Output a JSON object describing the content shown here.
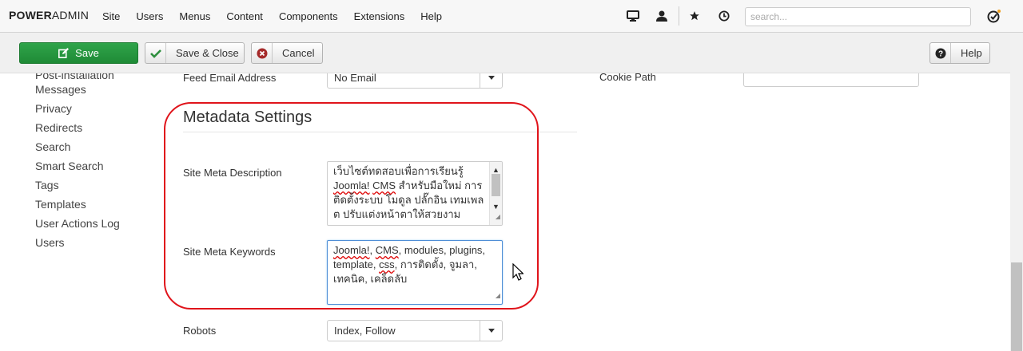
{
  "navbar": {
    "brand_bold": "POWER",
    "brand_rest": "ADMIN",
    "menu": [
      "Site",
      "Users",
      "Menus",
      "Content",
      "Components",
      "Extensions",
      "Help"
    ],
    "search_placeholder": "search..."
  },
  "toolbar": {
    "save_label": "Save",
    "save_close_label": "Save & Close",
    "cancel_label": "Cancel",
    "help_label": "Help"
  },
  "sidebar": {
    "items": [
      "Post-installation",
      "Messages",
      "Privacy",
      "Redirects",
      "Search",
      "Smart Search",
      "Tags",
      "Templates",
      "User Actions Log",
      "Users"
    ]
  },
  "form": {
    "feed_email_label": "Feed Email Address",
    "feed_email_value": "No Email",
    "cookie_path_label": "Cookie Path",
    "metadata_title": "Metadata Settings",
    "meta_description_label": "Site Meta Description",
    "meta_description_lines": [
      "เว็บไซต์ทดสอบเพื่อการเรียนรู้",
      "Joomla! CMS สำหรับมือใหม่ การ",
      "ติดตั้งระบบ โมดูล ปลั๊กอิน เทมเพล",
      "ต ปรับแต่งหน้าตาให้สวยงาม"
    ],
    "meta_keywords_label": "Site Meta Keywords",
    "meta_keywords_lines": [
      "Joomla!, CMS, modules, plugins,",
      "template, css, การติดตั้ง, จูมลา,",
      "เทคนิค, เคล็ดลับ"
    ],
    "robots_label": "Robots",
    "robots_value": "Index, Follow"
  },
  "colors": {
    "save_green": "#2fa44a",
    "highlight_red": "#e0141b",
    "focus_blue": "#4f8ed6"
  }
}
